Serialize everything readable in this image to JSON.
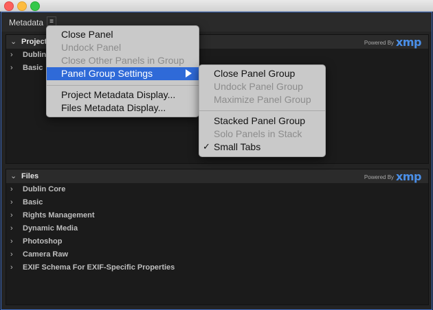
{
  "window": {
    "lights": [
      "close",
      "minimize",
      "zoom"
    ]
  },
  "panel": {
    "tab_label": "Metadata",
    "menu_icon": "≡"
  },
  "powered_by": {
    "prefix": "Powered By",
    "brand": "xmp"
  },
  "project_section": {
    "title": "Project",
    "rows": [
      {
        "label": "Dublin"
      },
      {
        "label": "Basic"
      }
    ]
  },
  "files_section": {
    "title": "Files",
    "rows": [
      {
        "label": "Dublin Core"
      },
      {
        "label": "Basic"
      },
      {
        "label": "Rights Management"
      },
      {
        "label": "Dynamic Media"
      },
      {
        "label": "Photoshop"
      },
      {
        "label": "Camera Raw"
      },
      {
        "label": "EXIF Schema For EXIF-Specific Properties"
      }
    ]
  },
  "main_menu": {
    "items": [
      {
        "label": "Close Panel",
        "enabled": true
      },
      {
        "label": "Undock Panel",
        "enabled": false
      },
      {
        "label": "Close Other Panels in Group",
        "enabled": false
      },
      {
        "label": "Panel Group Settings",
        "enabled": true,
        "highlighted": true
      },
      {
        "label": "Project Metadata Display...",
        "enabled": true
      },
      {
        "label": "Files Metadata Display...",
        "enabled": true
      }
    ]
  },
  "submenu": {
    "items": [
      {
        "label": "Close Panel Group",
        "enabled": true
      },
      {
        "label": "Undock Panel Group",
        "enabled": false
      },
      {
        "label": "Maximize Panel Group",
        "enabled": false
      },
      {
        "label": "Stacked Panel Group",
        "enabled": true
      },
      {
        "label": "Solo Panels in Stack",
        "enabled": false
      },
      {
        "label": "Small Tabs",
        "enabled": true,
        "checked": true
      }
    ],
    "check_mark": "✓"
  },
  "colors": {
    "accent": "#2f6ad8",
    "xmp_blue": "#4a8fe8",
    "background": "#232323"
  }
}
